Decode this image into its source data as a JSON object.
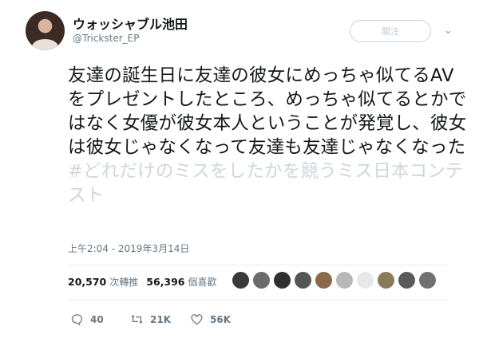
{
  "author": {
    "display_name": "ウォッシャブル池田",
    "handle": "@Trickster_EP"
  },
  "follow_button": {
    "label": "關注"
  },
  "tweet": {
    "text": "友達の誕生日に友達の彼女にめっちゃ似てるAVをプレゼントしたところ、めっちゃ似てるとかではなく女優が彼女本人ということが発覚し、彼女は彼女じゃなくなって友達も友達じゃなくなった",
    "hashtag": "#どれだけのミスをしたかを競うミス日本コンテスト"
  },
  "timestamp": "上午2:04 - 2019年3月14日",
  "stats": {
    "retweets_count": "20,570",
    "retweets_label": "次轉推",
    "likes_count": "56,396",
    "likes_label": "個喜歡"
  },
  "liker_avatars": [
    {
      "name": "liker-avatar",
      "color": "#3a3a3a"
    },
    {
      "name": "liker-avatar",
      "color": "#6b6b6b"
    },
    {
      "name": "liker-avatar",
      "color": "#2f2f2f"
    },
    {
      "name": "liker-avatar",
      "color": "#555555"
    },
    {
      "name": "liker-avatar",
      "color": "#8a6a4a"
    },
    {
      "name": "liker-avatar",
      "color": "#b8b8b8"
    },
    {
      "name": "liker-avatar",
      "color": "#e8e8e8"
    },
    {
      "name": "liker-avatar",
      "color": "#8a7a5a"
    },
    {
      "name": "liker-avatar",
      "color": "#5a5a5a"
    },
    {
      "name": "liker-avatar",
      "color": "#707070"
    }
  ],
  "actions": {
    "replies": "40",
    "retweets": "21K",
    "likes": "56K"
  },
  "colors": {
    "text": "#14171a",
    "secondary": "#657786",
    "hashtag": "#cfd6dc"
  }
}
